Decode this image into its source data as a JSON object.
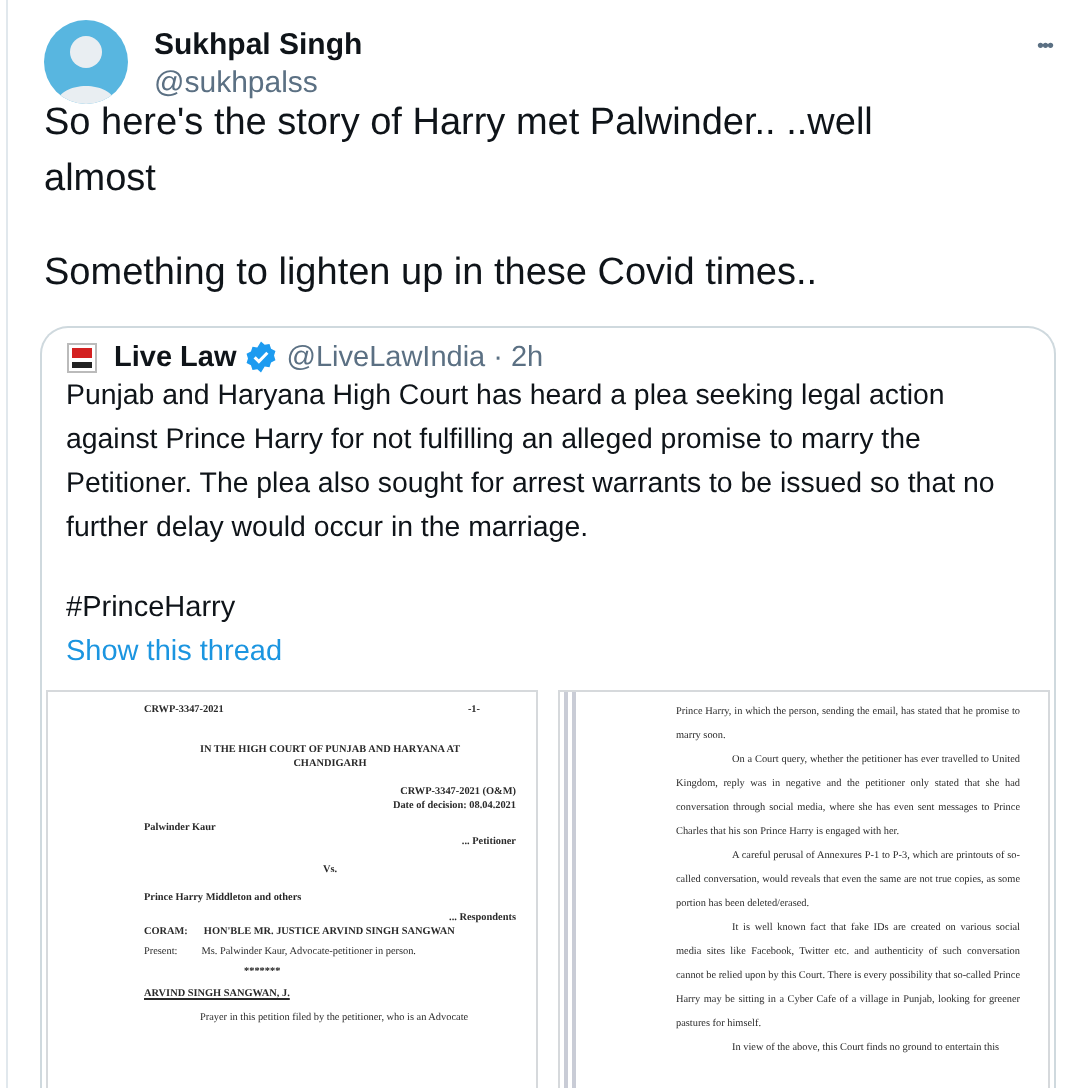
{
  "tweet": {
    "author": {
      "name": "Sukhpal Singh",
      "handle": "@sukhpalss"
    },
    "more": "•••",
    "paragraphs": [
      "So here's the story of Harry met Palwinder.. ..well almost",
      "Something to lighten up in these Covid times.."
    ],
    "quote": {
      "source": {
        "name": "Live Law",
        "verified": true,
        "handle": "@LiveLawIndia",
        "separator": "·",
        "time": "2h"
      },
      "text": "Punjab and Haryana High Court has heard a plea seeking legal action against Prince Harry for not fulfilling an alleged promise to marry the Petitioner. The plea also sought for arrest warrants to be issued so that no further delay would occur in the marriage.",
      "hashtag": "#PrinceHarry",
      "show_thread": "Show this thread",
      "documents": [
        {
          "blocks": [
            {
              "kind": "header",
              "left": "CRWP-3347-2021",
              "right": "-1-"
            },
            {
              "kind": "heading",
              "text": "IN THE HIGH COURT OF PUNJAB AND HARYANA AT CHANDIGARH"
            },
            {
              "kind": "right",
              "text": "CRWP-3347-2021 (O&M)"
            },
            {
              "kind": "right",
              "text": "Date of decision: 08.04.2021"
            },
            {
              "kind": "left",
              "text": "Palwinder Kaur"
            },
            {
              "kind": "right",
              "text": "... Petitioner"
            },
            {
              "kind": "center",
              "text": "Vs."
            },
            {
              "kind": "left",
              "text": "Prince Harry Middleton and others"
            },
            {
              "kind": "right",
              "text": "... Respondents"
            },
            {
              "kind": "labelled",
              "label": "CORAM:",
              "text": "HON'BLE MR. JUSTICE ARVIND SINGH SANGWAN"
            },
            {
              "kind": "present",
              "label": "Present:",
              "text": "Ms. Palwinder Kaur, Advocate-petitioner in person."
            },
            {
              "kind": "stars",
              "text": "*******"
            },
            {
              "kind": "judge",
              "text": "ARVIND SINGH SANGWAN, J."
            },
            {
              "kind": "paragraph",
              "text": "Prayer in this petition filed by the petitioner, who is an Advocate"
            }
          ]
        },
        {
          "blocks": [
            {
              "kind": "continued",
              "text": "Prince Harry, in which the person, sending the email, has stated that he promise to marry soon."
            },
            {
              "kind": "paragraph",
              "text": "On a Court query, whether the petitioner has ever travelled to United Kingdom, reply was in negative and the petitioner only stated that she had conversation through social media, where she has even sent messages to Prince Charles that his son Prince Harry is engaged with her."
            },
            {
              "kind": "paragraph",
              "text": "A careful perusal of Annexures P-1 to P-3, which are printouts of so-called conversation, would reveals that even the same are not true copies, as some portion has been deleted/erased."
            },
            {
              "kind": "paragraph",
              "text": "It is well known fact that fake IDs are created on various social media sites like Facebook, Twitter etc. and authenticity of such conversation cannot be relied upon by this Court. There is every possibility that so-called Prince Harry may be sitting in a Cyber Cafe of a village in Punjab, looking for greener pastures for himself."
            },
            {
              "kind": "paragraph",
              "text": "In view of the above, this Court finds no ground to entertain this"
            }
          ]
        }
      ]
    }
  }
}
